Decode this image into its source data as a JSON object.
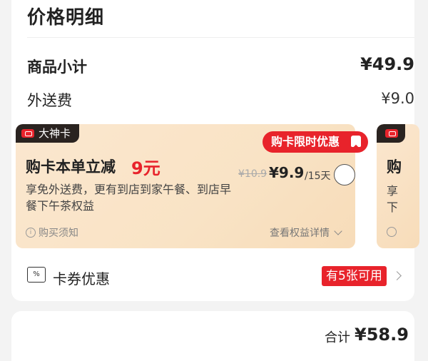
{
  "header": {
    "title": "价格明细"
  },
  "rows": {
    "subtotal": {
      "label": "商品小计",
      "value": "¥49.9"
    },
    "delivery": {
      "label": "外送费",
      "value": "¥9.0"
    }
  },
  "promo": {
    "badge": "大神卡",
    "limited_tag": "购卡限时优惠",
    "title": "购卡本单立减",
    "amount": "9元",
    "desc": "享免外送费，更有到店到家午餐、到店早餐下午茶权益",
    "price_old": "¥10.9",
    "price_new": "¥9.9",
    "price_period": "/15天",
    "notice": "购买须知",
    "details": "查看权益详情"
  },
  "promo_peek": {
    "title": "购",
    "desc_line1": "享",
    "desc_line2": "下"
  },
  "coupon": {
    "label": "卡券优惠",
    "badge": "有5张可用"
  },
  "footer": {
    "total_label": "合计",
    "total_value": "¥58.9"
  },
  "colors": {
    "accent_red": "#e8232b",
    "promo_bg": "#fbe7cf",
    "badge_dark": "#2a2320"
  }
}
